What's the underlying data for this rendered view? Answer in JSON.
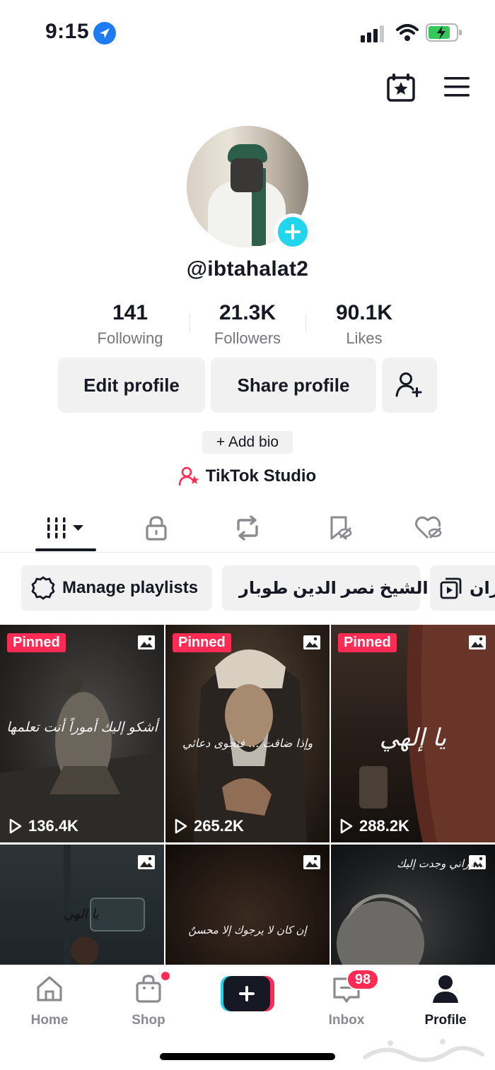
{
  "status": {
    "time": "9:15"
  },
  "profile": {
    "username": "@ibtahalat2",
    "stats": [
      {
        "value": "141",
        "label": "Following"
      },
      {
        "value": "21.3K",
        "label": "Followers"
      },
      {
        "value": "90.1K",
        "label": "Likes"
      }
    ],
    "edit_label": "Edit profile",
    "share_label": "Share profile",
    "add_bio_label": "+ Add bio",
    "studio_label": "TikTok Studio"
  },
  "tabs": [
    "videos-grid",
    "private",
    "reposts",
    "favorites",
    "liked"
  ],
  "playlists": {
    "manage_label": "Manage playlists",
    "items": [
      {
        "label": "الشيخ نصر الدين طوبار"
      },
      {
        "label": "مران"
      }
    ]
  },
  "videos": [
    {
      "pinned": "Pinned",
      "views": "136.4K",
      "caption": "أشكو إليك أموراً أنت تعلمها"
    },
    {
      "pinned": "Pinned",
      "views": "265.2K",
      "caption": "وإذا ضاقت ... فنجوى دعائي"
    },
    {
      "pinned": "Pinned",
      "views": "288.2K",
      "caption": "يا إلهي"
    },
    {
      "caption": "يا الهي"
    },
    {
      "caption": "إن كان لا يرجوك إلا محسنٌ"
    },
    {
      "caption": "وراني وجدت إليك..."
    }
  ],
  "nav": {
    "home": "Home",
    "shop": "Shop",
    "inbox": "Inbox",
    "inbox_badge": "98",
    "profile": "Profile"
  },
  "colors": {
    "accent": "#fe2c55",
    "cyan": "#20d5ec",
    "text": "#161823"
  }
}
